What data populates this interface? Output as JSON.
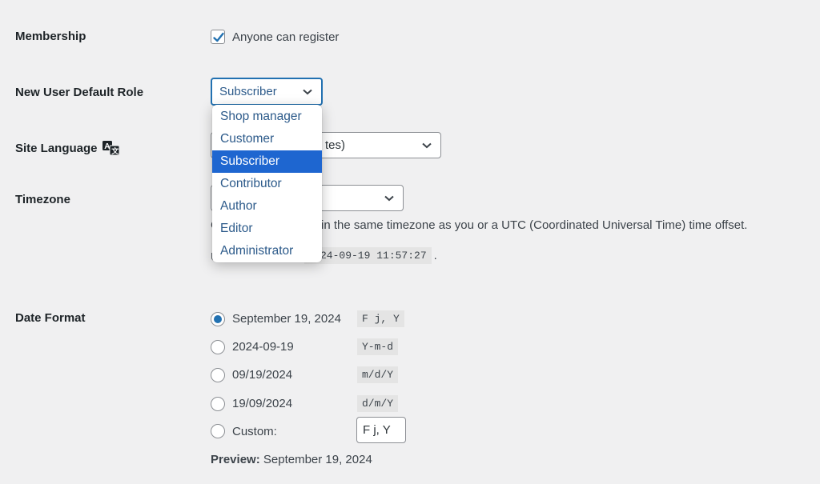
{
  "membership": {
    "label": "Membership",
    "checkbox_label": "Anyone can register",
    "checked": true
  },
  "default_role": {
    "label": "New User Default Role",
    "selected": "Subscriber",
    "options": [
      "Shop manager",
      "Customer",
      "Subscriber",
      "Contributor",
      "Author",
      "Editor",
      "Administrator"
    ],
    "highlighted_index": 2
  },
  "site_language": {
    "label": "Site Language",
    "icon": "translation-icon",
    "partial_value": "tes)"
  },
  "timezone": {
    "label": "Timezone",
    "description": "in the same timezone as you or a UTC (Coordinated Universal Time) time offset.",
    "prefix_char_desc": "C",
    "utc_prefix_char": "U",
    "utc_time_partial": "24-09-19 11:57:27",
    "utc_time_suffix": "."
  },
  "date_format": {
    "label": "Date Format",
    "options": [
      {
        "display": "September 19, 2024",
        "code": "F j, Y",
        "checked": true
      },
      {
        "display": "2024-09-19",
        "code": "Y-m-d",
        "checked": false
      },
      {
        "display": "09/19/2024",
        "code": "m/d/Y",
        "checked": false
      },
      {
        "display": "19/09/2024",
        "code": "d/m/Y",
        "checked": false
      }
    ],
    "custom_label": "Custom:",
    "custom_value": "F j, Y",
    "preview_label": "Preview:",
    "preview_value": "September 19, 2024"
  },
  "colors": {
    "accent": "#2271b1",
    "highlight": "#1e66d0",
    "background": "#f0f0f1"
  }
}
